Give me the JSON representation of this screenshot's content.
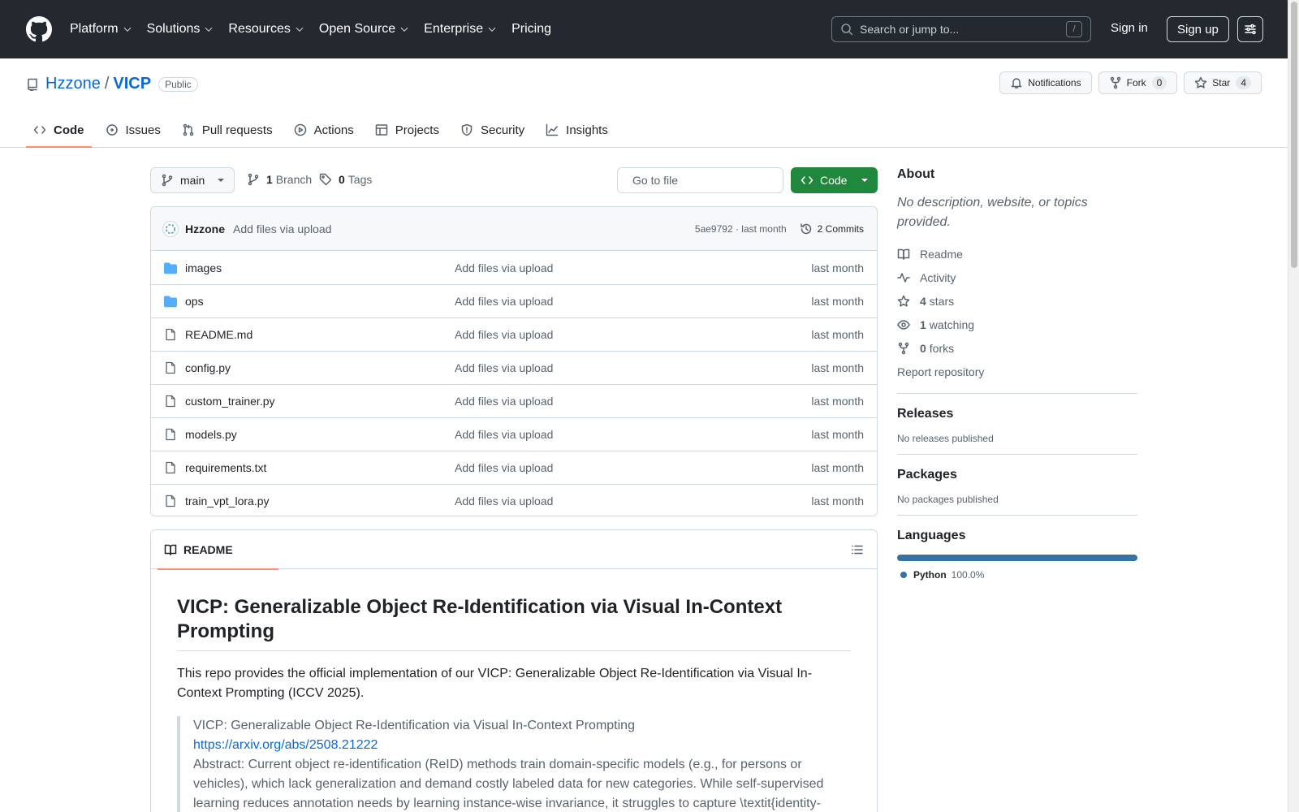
{
  "header": {
    "nav": [
      {
        "label": "Platform",
        "dropdown": true
      },
      {
        "label": "Solutions",
        "dropdown": true
      },
      {
        "label": "Resources",
        "dropdown": true
      },
      {
        "label": "Open Source",
        "dropdown": true
      },
      {
        "label": "Enterprise",
        "dropdown": true
      },
      {
        "label": "Pricing",
        "dropdown": false
      }
    ],
    "search_placeholder": "Search or jump to...",
    "search_shortcut": "/",
    "signin": "Sign in",
    "signup": "Sign up"
  },
  "repo": {
    "owner": "Hzzone",
    "separator": "/",
    "name": "VICP",
    "visibility": "Public",
    "notifications_label": "Notifications",
    "fork_label": "Fork",
    "fork_count": "0",
    "star_label": "Star",
    "star_count": "4"
  },
  "tabs": [
    "Code",
    "Issues",
    "Pull requests",
    "Actions",
    "Projects",
    "Security",
    "Insights"
  ],
  "toolbar": {
    "branch": "main",
    "branch_count": "1",
    "branch_label": "Branch",
    "tag_count": "0",
    "tag_label": "Tags",
    "goto_placeholder": "Go to file",
    "code_button": "Code"
  },
  "commit": {
    "author": "Hzzone",
    "message": "Add files via upload",
    "sha_time": "5ae9792 · last month",
    "commits_label": "2 Commits"
  },
  "files": [
    {
      "name": "images",
      "type": "dir",
      "message": "Add files via upload",
      "date": "last month"
    },
    {
      "name": "ops",
      "type": "dir",
      "message": "Add files via upload",
      "date": "last month"
    },
    {
      "name": "README.md",
      "type": "file",
      "message": "Add files via upload",
      "date": "last month"
    },
    {
      "name": "config.py",
      "type": "file",
      "message": "Add files via upload",
      "date": "last month"
    },
    {
      "name": "custom_trainer.py",
      "type": "file",
      "message": "Add files via upload",
      "date": "last month"
    },
    {
      "name": "models.py",
      "type": "file",
      "message": "Add files via upload",
      "date": "last month"
    },
    {
      "name": "requirements.txt",
      "type": "file",
      "message": "Add files via upload",
      "date": "last month"
    },
    {
      "name": "train_vpt_lora.py",
      "type": "file",
      "message": "Add files via upload",
      "date": "last month"
    }
  ],
  "readme": {
    "tab_label": "README",
    "title": "VICP: Generalizable Object Re-Identification via Visual In-Context Prompting",
    "intro": "This repo provides the official implementation of our VICP: Generalizable Object Re-Identification via Visual In-Context Prompting (ICCV 2025).",
    "quote_title": "VICP: Generalizable Object Re-Identification via Visual In-Context Prompting",
    "quote_link": "https://arxiv.org/abs/2508.21222",
    "quote_abstract": "Abstract: Current object re-identification (ReID) methods train domain-specific models (e.g., for persons or vehicles), which lack generalization and demand costly labeled data for new categories. While self-supervised learning reduces annotation needs by learning instance-wise invariance, it struggles to capture \\textit{identity-"
  },
  "sidebar": {
    "about_title": "About",
    "description": "No description, website, or topics provided.",
    "readme": "Readme",
    "activity": "Activity",
    "stars_count": "4",
    "stars_label": "stars",
    "watching_count": "1",
    "watching_label": "watching",
    "forks_count": "0",
    "forks_label": "forks",
    "report": "Report repository",
    "releases_title": "Releases",
    "releases_empty": "No releases published",
    "packages_title": "Packages",
    "packages_empty": "No packages published",
    "languages_title": "Languages",
    "languages": [
      {
        "name": "Python",
        "percent": "100.0%",
        "color": "#3572a5"
      }
    ]
  }
}
